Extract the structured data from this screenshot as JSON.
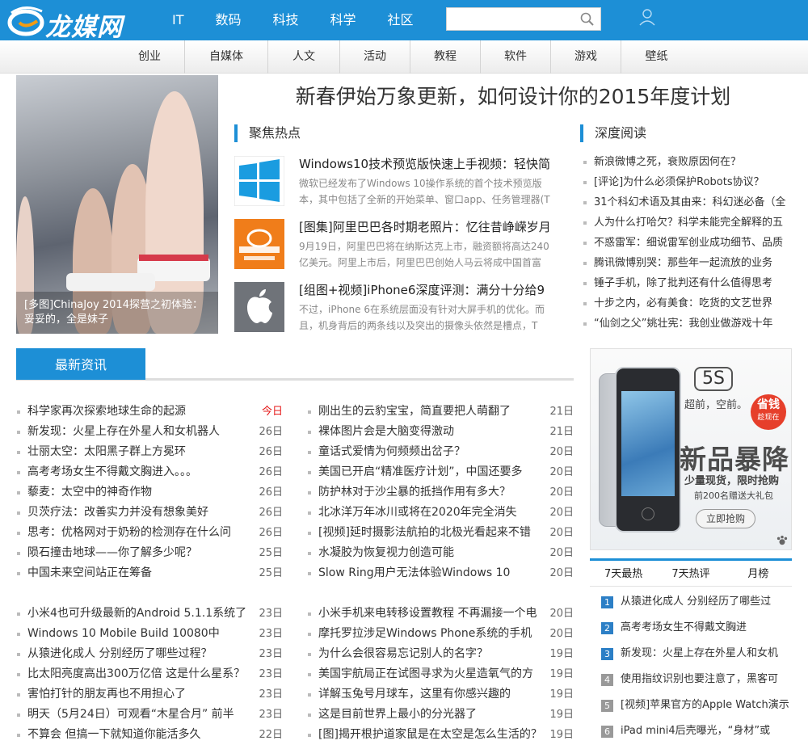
{
  "site": {
    "name": "龙媒网"
  },
  "main_nav": [
    "IT",
    "数码",
    "科技",
    "科学",
    "社区"
  ],
  "search": {
    "placeholder": ""
  },
  "sub_nav": [
    "创业",
    "自媒体",
    "人文",
    "活动",
    "教程",
    "软件",
    "游戏",
    "壁纸"
  ],
  "feature": {
    "caption": "[多图]ChinaJoy 2014探营之初体验：妥妥的，全是妹子"
  },
  "headline": "新春伊始万象更新，如何设计你的2015年度计划",
  "focus": {
    "title": "聚焦热点",
    "items": [
      {
        "title": "Windows10技术预览版快速上手视频：轻快简",
        "desc": "微软已经发布了Windows 10操作系统的首个技术预览版本，其中包括了全新的开始菜单、窗口app、任务管理器(T",
        "icon": "windows-logo-icon"
      },
      {
        "title": "[图集]阿里巴巴各时期老照片：忆往昔峥嵘岁月",
        "desc": "9月19日，阿里巴巴将在纳斯达克上市，融资额将高达240亿美元。阿里上市后，阿里巴巴创始人马云将成中国首富",
        "icon": "alibaba-logo-icon"
      },
      {
        "title": "[组图+视频]iPhone6深度评测：满分十分给9",
        "desc": "不过，iPhone 6在系统层面没有针对大屏手机的优化。而且，机身背后的两条线以及突出的摄像头依然是槽点，T",
        "icon": "apple-logo-icon"
      }
    ]
  },
  "deep": {
    "title": "深度阅读",
    "items": [
      "新浪微博之死，衰败原因何在？",
      "[评论]为什么必须保护Robots协议？",
      "31个科幻术语及其由来：科幻迷必备（全",
      "人为什么打哈欠？科学未能完全解释的五",
      "不惑雷军：细说雷军创业成功细节、品质",
      "腾讯微博别哭：那些年一起流放的业务",
      "锤子手机，除了批判还有什么值得思考",
      "十步之内，必有美食：吃货的文艺世界",
      "“仙剑之父”姚壮宪：我创业做游戏十年"
    ]
  },
  "latest": {
    "title": "最新资讯",
    "col1a": [
      {
        "t": "科学家再次探索地球生命的起源",
        "d": "今日"
      },
      {
        "t": "新发现：火星上存在外星人和女机器人",
        "d": "26日"
      },
      {
        "t": "壮丽太空：太阳黑子群上方冕环",
        "d": "26日"
      },
      {
        "t": "高考考场女生不得戴文胸进入。。。",
        "d": "26日"
      },
      {
        "t": "藜麦：太空中的神奇作物",
        "d": "26日"
      },
      {
        "t": "贝茨疗法：改善实力并没有想象美好",
        "d": "26日"
      },
      {
        "t": "思考：优格网对于奶粉的检测存在什么问",
        "d": "26日"
      },
      {
        "t": "陨石撞击地球——你了解多少呢？",
        "d": "25日"
      },
      {
        "t": "中国未来空间站正在筹备",
        "d": "25日"
      }
    ],
    "col2a": [
      {
        "t": "刚出生的云豹宝宝，简直要把人萌翻了",
        "d": "21日"
      },
      {
        "t": "裸体图片会是大脑变得激动",
        "d": "21日"
      },
      {
        "t": "童话式爱情为何频频出岔子？",
        "d": "20日"
      },
      {
        "t": "美国已开启“精准医疗计划”，中国还要多",
        "d": "20日"
      },
      {
        "t": "防护林对于沙尘暴的抵挡作用有多大？",
        "d": "20日"
      },
      {
        "t": "北冰洋万年冰川或将在2020年完全消失",
        "d": "20日"
      },
      {
        "t": "[视频]延时摄影法航拍的北极光看起来不错",
        "d": "20日"
      },
      {
        "t": "水凝胶为恢复视力创造可能",
        "d": "20日"
      },
      {
        "t": "Slow Ring用户无法体验Windows 10",
        "d": "20日"
      }
    ],
    "col1b": [
      {
        "t": "小米4也可升级最新的Android 5.1.1系统了",
        "d": "23日"
      },
      {
        "t": "Windows 10 Mobile Build 10080中",
        "d": "23日"
      },
      {
        "t": "从猿进化成人 分别经历了哪些过程？",
        "d": "23日"
      },
      {
        "t": "比太阳亮度高出300万亿倍 这是什么星系？",
        "d": "23日"
      },
      {
        "t": "害怕打针的朋友再也不用担心了",
        "d": "23日"
      },
      {
        "t": "明天（5月24日）可观看“木星合月” 前半",
        "d": "23日"
      },
      {
        "t": "不算会 但搞一下就知道你能活多久",
        "d": "22日"
      }
    ],
    "col2b": [
      {
        "t": "小米手机来电转移设置教程 不再漏接一个电",
        "d": "20日"
      },
      {
        "t": "摩托罗拉涉足Windows Phone系统的手机",
        "d": "20日"
      },
      {
        "t": "为什么会很容易忘记别人的名字？",
        "d": "19日"
      },
      {
        "t": "美国宇航局正在试图寻求为火星造氧气的方",
        "d": "19日"
      },
      {
        "t": "详解玉兔号月球车，这里有你感兴趣的",
        "d": "19日"
      },
      {
        "t": "这是目前世界上最小的分光器了",
        "d": "19日"
      },
      {
        "t": "[图]揭开根护道家鼠是在太空是怎么生活的？",
        "d": "19日"
      }
    ]
  },
  "ad": {
    "model": "5S",
    "slogan": "超前，空前。",
    "badge1": "省钱",
    "badge2": "趁现在",
    "headline": "新品暴降",
    "sub": "少量现货，限时抢购",
    "gift": "前200名赠送大礼包",
    "cta": "立即抢购"
  },
  "rank": {
    "tabs": [
      "7天最热",
      "7天热评",
      "月榜"
    ],
    "items": [
      {
        "n": "1",
        "t": "从猿进化成人 分别经历了哪些过"
      },
      {
        "n": "2",
        "t": "高考考场女生不得戴文胸进"
      },
      {
        "n": "3",
        "t": "新发现：火星上存在外星人和女机"
      },
      {
        "n": "4",
        "t": "使用指纹识别也要注意了，黑客可"
      },
      {
        "n": "5",
        "t": "[视频]苹果官方的Apple Watch演示"
      },
      {
        "n": "6",
        "t": "iPad mini4后壳曝光，“身材”或"
      }
    ]
  },
  "colors": {
    "brand": "#1d8fd6",
    "accent_date": "#e51a1a",
    "rank_hot": "#2c7fc6"
  }
}
